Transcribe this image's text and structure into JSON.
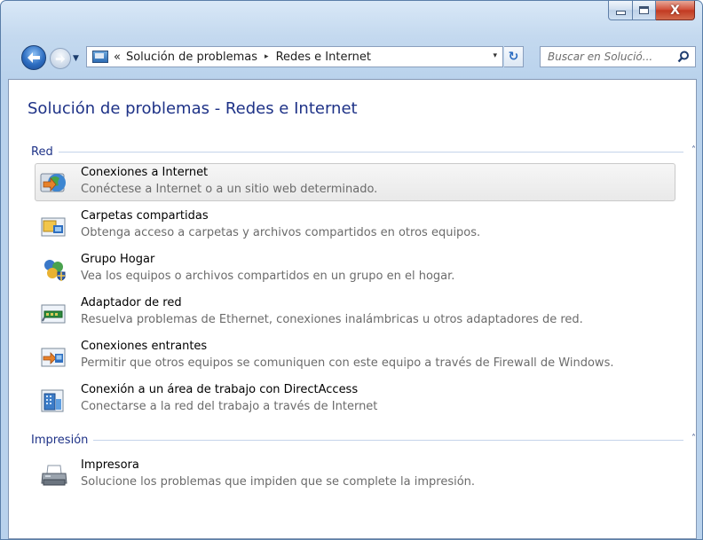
{
  "window": {
    "caption_buttons": {
      "minimize_icon": "minimize-icon",
      "maximize_icon": "maximize-icon",
      "close_icon": "close-icon",
      "close_glyph": "X"
    }
  },
  "toolbar": {
    "address": {
      "overflow_glyph": "«",
      "breadcrumbs": [
        "Solución de problemas",
        "Redes e Internet"
      ],
      "separator_glyph": "▸",
      "dropdown_glyph": "▾"
    },
    "refresh_glyph": "↻",
    "search": {
      "placeholder": "Buscar en Solució..."
    }
  },
  "page": {
    "title": "Solución de problemas - Redes e Internet",
    "sections": [
      {
        "label": "Red",
        "collapse_glyph": "˄",
        "items": [
          {
            "title": "Conexiones a Internet",
            "description": "Conéctese a Internet o a un sitio web determinado.",
            "icon": "internet-connection-icon",
            "selected": true
          },
          {
            "title": "Carpetas compartidas",
            "description": "Obtenga acceso a carpetas y archivos compartidos en otros equipos.",
            "icon": "shared-folders-icon",
            "selected": false
          },
          {
            "title": "Grupo Hogar",
            "description": "Vea los equipos o archivos compartidos en un grupo en el hogar.",
            "icon": "homegroup-icon",
            "selected": false
          },
          {
            "title": "Adaptador de red",
            "description": "Resuelva problemas de Ethernet, conexiones inalámbricas u otros adaptadores de red.",
            "icon": "network-adapter-icon",
            "selected": false
          },
          {
            "title": "Conexiones entrantes",
            "description": "Permitir que otros equipos se comuniquen con este equipo a través de Firewall de Windows.",
            "icon": "incoming-connections-icon",
            "selected": false
          },
          {
            "title": "Conexión a un área de trabajo con DirectAccess",
            "description": "Conectarse a la red del trabajo a través de Internet",
            "icon": "directaccess-icon",
            "selected": false
          }
        ]
      },
      {
        "label": "Impresión",
        "collapse_glyph": "˄",
        "items": [
          {
            "title": "Impresora",
            "description": "Solucione los problemas que impiden que se complete la impresión.",
            "icon": "printer-icon",
            "selected": false
          }
        ]
      }
    ]
  },
  "colors": {
    "title_blue": "#1e3287",
    "description_gray": "#6b6b6b",
    "frame_blue": "#b9d2ec"
  }
}
